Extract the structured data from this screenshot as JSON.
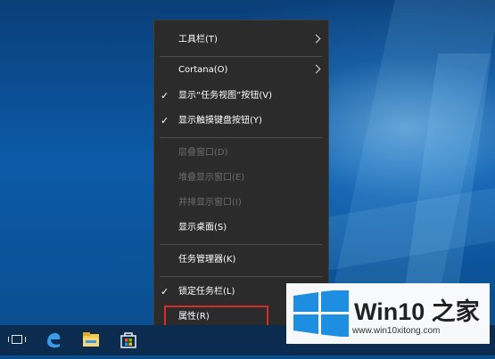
{
  "context_menu": {
    "items": [
      {
        "label": "工具栏(T)",
        "checked": false,
        "disabled": false,
        "submenu": true
      },
      {
        "label": "Cortana(O)",
        "checked": false,
        "disabled": false,
        "submenu": true
      },
      {
        "label": "显示“任务视图”按钮(V)",
        "checked": true,
        "disabled": false,
        "submenu": false
      },
      {
        "label": "显示触摸键盘按钮(Y)",
        "checked": true,
        "disabled": false,
        "submenu": false
      },
      {
        "label": "层叠窗口(D)",
        "checked": false,
        "disabled": true,
        "submenu": false
      },
      {
        "label": "堆叠显示窗口(E)",
        "checked": false,
        "disabled": true,
        "submenu": false
      },
      {
        "label": "并排显示窗口(I)",
        "checked": false,
        "disabled": true,
        "submenu": false
      },
      {
        "label": "显示桌面(S)",
        "checked": false,
        "disabled": false,
        "submenu": false
      },
      {
        "label": "任务管理器(K)",
        "checked": false,
        "disabled": false,
        "submenu": false
      },
      {
        "label": "锁定任务栏(L)",
        "checked": true,
        "disabled": false,
        "submenu": false
      },
      {
        "label": "属性(R)",
        "checked": false,
        "disabled": false,
        "submenu": false
      }
    ],
    "check_glyph": "✓",
    "highlight_color": "#d42b2b"
  },
  "taskbar": {
    "icons": [
      "task-view-icon",
      "edge-icon",
      "file-explorer-icon",
      "store-icon"
    ]
  },
  "watermark": {
    "title": "Win10 之家",
    "url": "www.win10xitong.com",
    "logo_color": "#1e8fe0"
  }
}
